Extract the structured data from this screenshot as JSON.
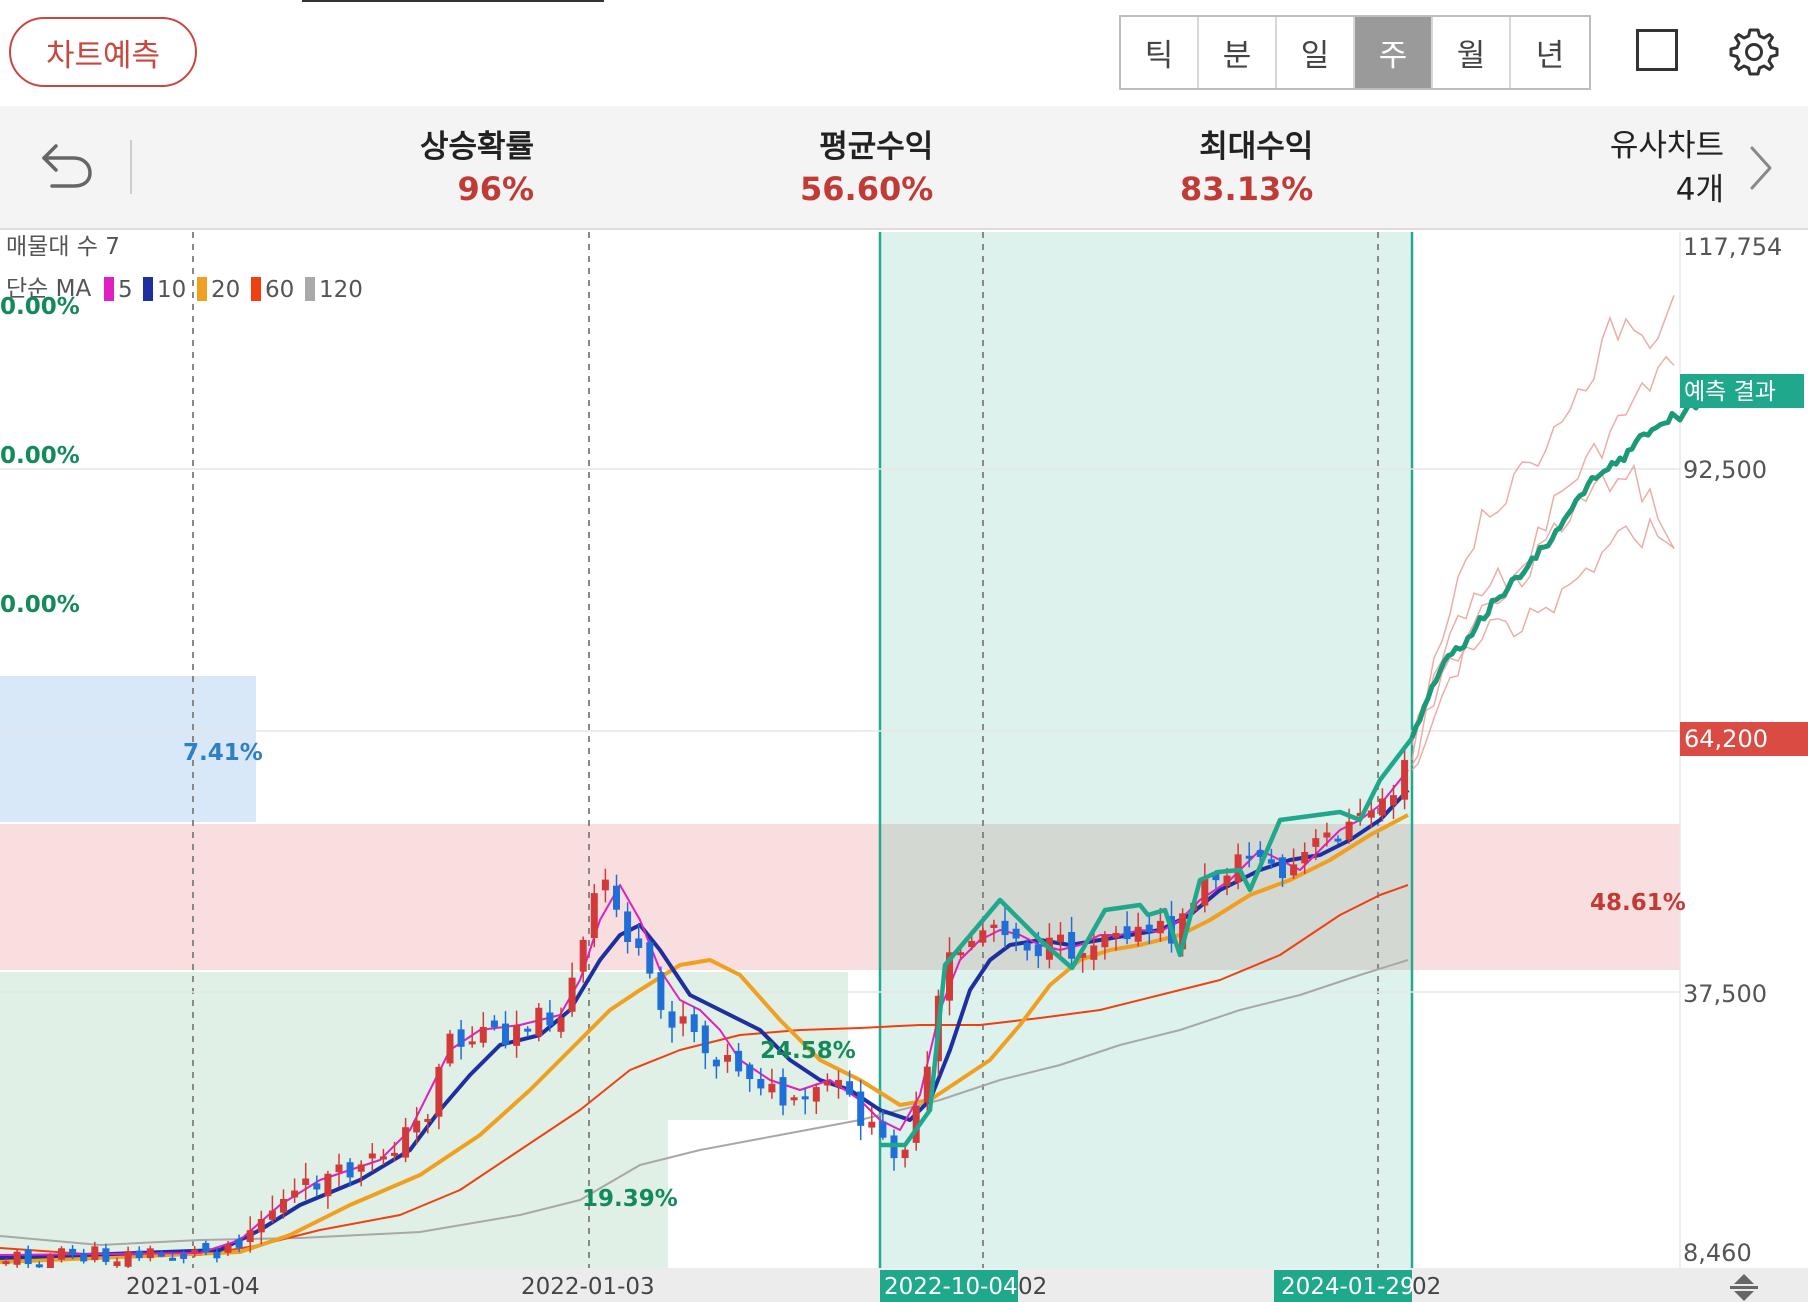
{
  "header": {
    "predict_button": "차트예측",
    "periods": [
      "틱",
      "분",
      "일",
      "주",
      "월",
      "년"
    ],
    "active_period": "주"
  },
  "stats": {
    "rise_prob_label": "상승확률",
    "rise_prob_value": "96%",
    "avg_return_label": "평균수익",
    "avg_return_value": "56.60%",
    "max_return_label": "최대수익",
    "max_return_value": "83.13%",
    "similar_label": "유사차트",
    "similar_value": "4개"
  },
  "overlay": {
    "volume_profile_label": "매물대 수 7",
    "ma_prefix": "단순 MA",
    "ma_legend": [
      {
        "period": "5",
        "color": "#e020c0"
      },
      {
        "period": "10",
        "color": "#1e2fa0"
      },
      {
        "period": "20",
        "color": "#f0a020"
      },
      {
        "period": "60",
        "color": "#f04010"
      },
      {
        "period": "120",
        "color": "#aaaaaa"
      }
    ],
    "zone_labels": [
      "0.00%",
      "0.00%",
      "0.00%",
      "7.41%",
      "48.61%",
      "24.58%",
      "19.39%"
    ],
    "prediction_tag": "예측 결과",
    "current_price_tag": "64,200"
  },
  "chart_data": {
    "type": "candlestick",
    "y_ticks": [
      "117,754",
      "92,500",
      "64,200",
      "37,500",
      "8,460"
    ],
    "x_ticks": [
      "2021-01-04",
      "2022-01-03",
      "2022-10-04",
      "2024-01-29"
    ],
    "x_tick_suffixes": [
      "02",
      "02"
    ],
    "ylim": [
      8460,
      117754
    ],
    "current_price": 64200,
    "prediction_end": 98000,
    "colors": {
      "up": "#d23a3a",
      "down": "#1f6fd6",
      "prediction": "#1a9a78",
      "similar": "#e8a098"
    }
  }
}
